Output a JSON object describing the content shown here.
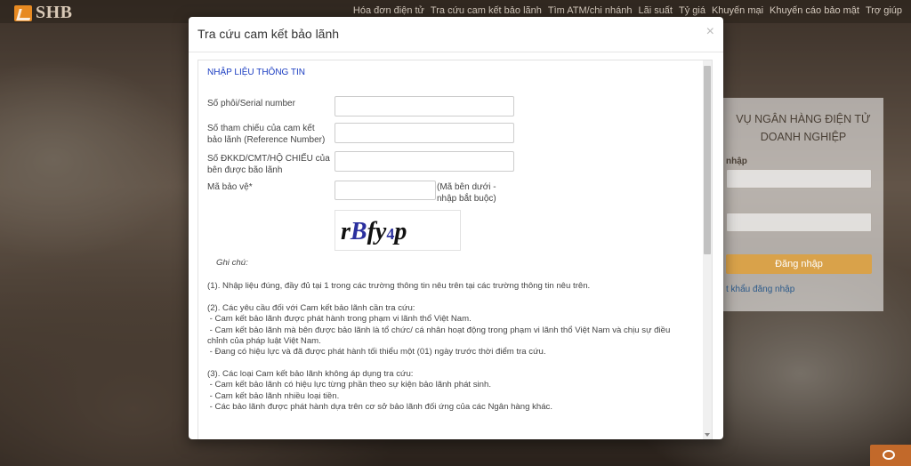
{
  "brand": {
    "logo_text": "SHB"
  },
  "nav": {
    "items": [
      "Hóa đơn điện tử",
      "Tra cứu cam kết bảo lãnh",
      "Tìm ATM/chi nhánh",
      "Lãi suất",
      "Tỷ giá",
      "Khuyến mại",
      "Khuyến cáo bảo mật",
      "Trợ giúp"
    ]
  },
  "login_panel": {
    "title_line1": "VỤ NGÂN HÀNG ĐIỆN TỬ",
    "title_line2": "DOANH NGHIỆP",
    "label": "nhập",
    "button": "Đăng nhập",
    "link": "t khẩu đăng nhập"
  },
  "modal": {
    "title": "Tra cứu cam kết bảo lãnh",
    "close": "×",
    "section_title": "NHẬP LIỆU THÔNG TIN",
    "fields": [
      {
        "label": "Số phôi/Serial number",
        "value": ""
      },
      {
        "label": "Số tham chiếu của cam kết bảo lãnh (Reference Number)",
        "value": ""
      },
      {
        "label": "Số ĐKKD/CMT/HỘ CHIẾU của bên được bão lãnh",
        "value": ""
      }
    ],
    "captcha": {
      "label": "Mã bảo vệ*",
      "value": "",
      "note": "(Mã bên dưới - nhập bắt buộc)",
      "image_text_part1": "r",
      "image_text_part2": "B",
      "image_text_part3": "fy",
      "image_text_part4": "4",
      "image_text_part5": "p"
    },
    "notes": {
      "heading": "Ghi chú:",
      "p1": "(1). Nhập liệu đúng, đầy đủ tại 1 trong các trường thông tin nêu trên tại các trường thông tin nêu trên.",
      "p2_title": "(2). Các yêu cầu đối với Cam kết bảo lãnh cần tra cứu:",
      "p2_l1": " - Cam kết bảo lãnh được phát hành trong phạm vi lãnh thổ Việt Nam.",
      "p2_l2": " - Cam kết bảo lãnh mà bên được bảo lãnh là tổ chức/ cá nhân hoạt động trong phạm vi lãnh thổ Việt Nam và chịu sự điều chỉnh của pháp luật Việt Nam.",
      "p2_l3": " - Đang có hiệu lực và đã được phát hành tối thiểu một (01) ngày trước thời điểm tra cứu.",
      "p3_title": "(3). Các loại Cam kết bảo lãnh không áp dụng tra cứu:",
      "p3_l1": " - Cam kết bảo lãnh có hiệu lực từng phần theo sự kiện bảo lãnh phát sinh.",
      "p3_l2": " - Cam kết bảo lãnh nhiều loại tiền.",
      "p3_l3": " - Các bảo lãnh được phát hành dựa trên cơ sở bảo lãnh đối ứng của các Ngân hàng khác."
    }
  },
  "colors": {
    "accent": "#1a3cc1",
    "brand_orange": "#e78a22",
    "login_button": "#d9a24a"
  },
  "icons": [
    "shb-logo-icon",
    "close-icon",
    "chat-icon",
    "scroll-down-icon"
  ]
}
